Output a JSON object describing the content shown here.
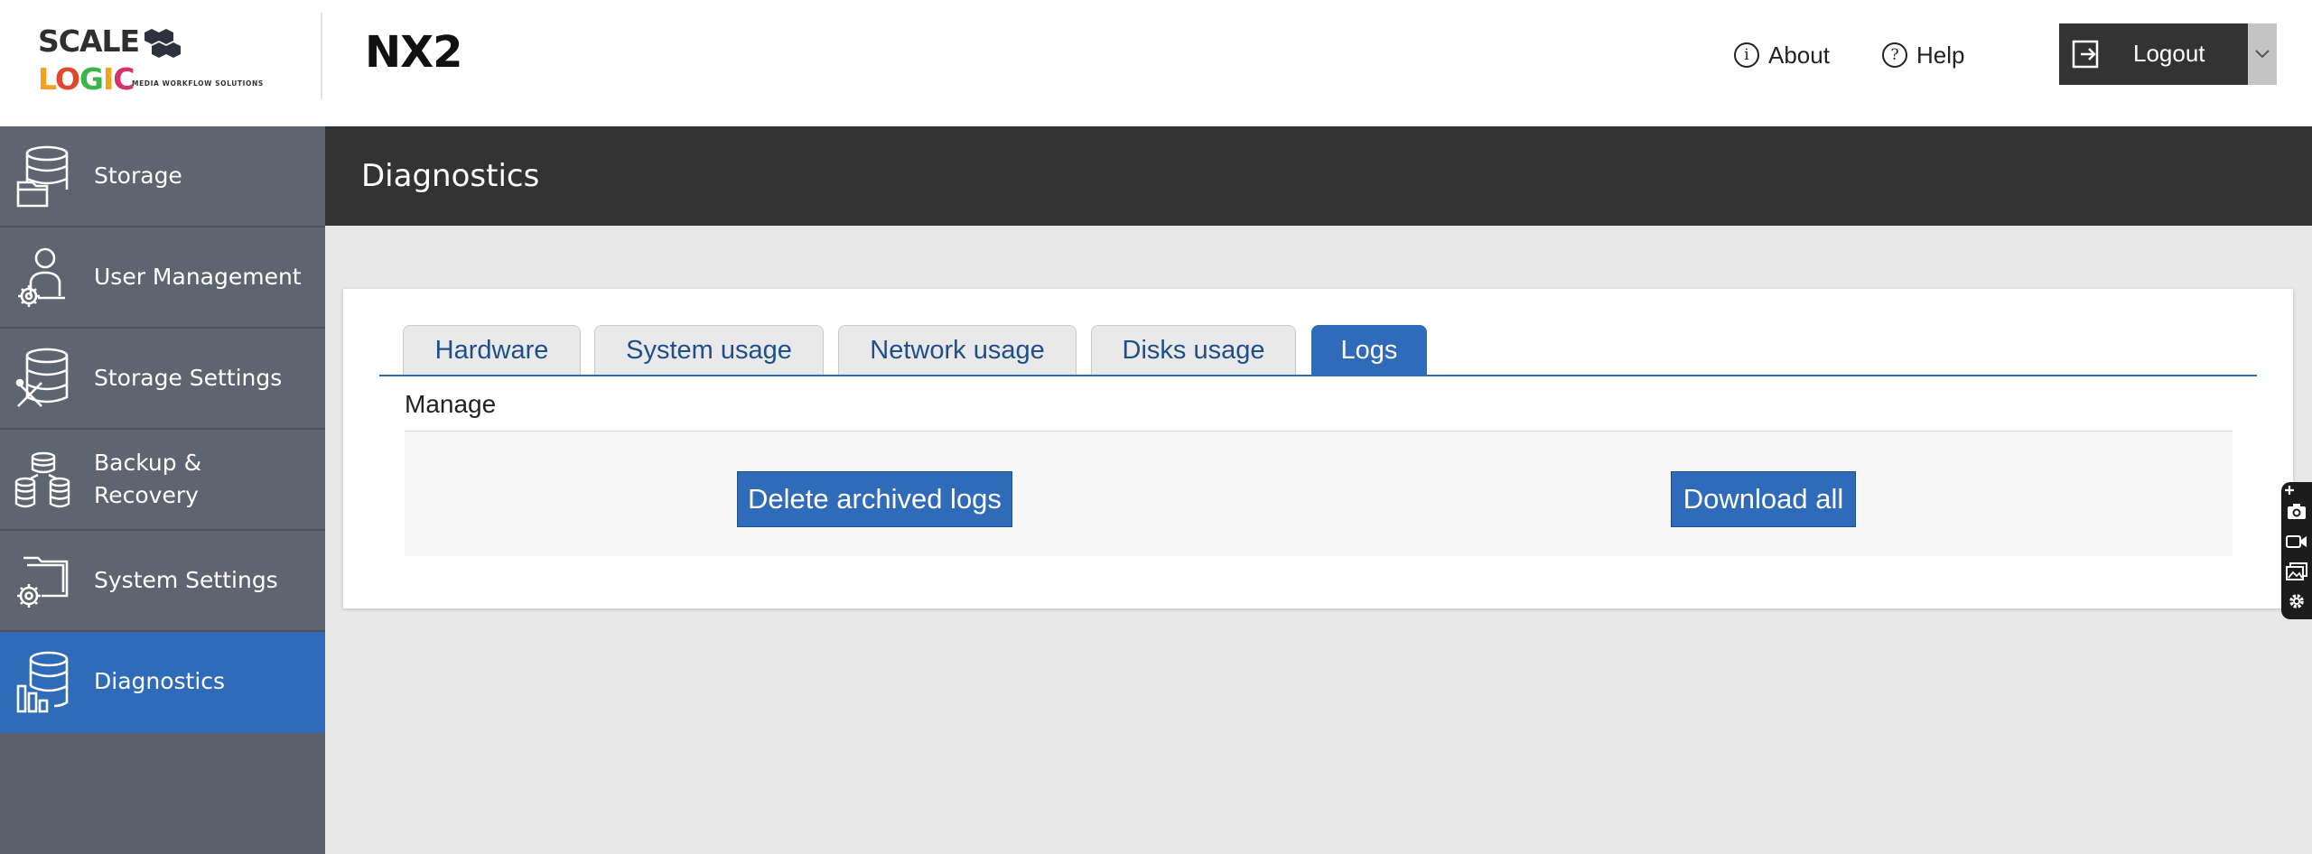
{
  "header": {
    "logo_scale": "SCALE",
    "logo_logic": "LOGIC",
    "logo_tagline": "MEDIA WORKFLOW SOLUTIONS",
    "product_name": "NX2",
    "about_label": "About",
    "help_label": "Help",
    "logout_label": "Logout"
  },
  "sidebar": {
    "items": [
      {
        "label": "Storage",
        "icon": "storage-icon"
      },
      {
        "label": "User Management",
        "icon": "user-management-icon"
      },
      {
        "label": "Storage Settings",
        "icon": "storage-settings-icon"
      },
      {
        "label": "Backup & Recovery",
        "icon": "backup-recovery-icon"
      },
      {
        "label": "System Settings",
        "icon": "system-settings-icon"
      },
      {
        "label": "Diagnostics",
        "icon": "diagnostics-icon",
        "active": true
      }
    ]
  },
  "main": {
    "title": "Diagnostics",
    "tabs": [
      {
        "label": "Hardware"
      },
      {
        "label": "System usage"
      },
      {
        "label": "Network usage"
      },
      {
        "label": "Disks usage"
      },
      {
        "label": "Logs",
        "active": true
      }
    ],
    "section_title": "Manage",
    "buttons": {
      "delete_archived_logs": "Delete archived logs",
      "download_all": "Download all"
    }
  },
  "floating_toolbar": {
    "icons": [
      "plus-icon",
      "camera-icon",
      "video-icon",
      "image-icon",
      "settings-icon"
    ]
  },
  "colors": {
    "accent": "#2f6bb8",
    "sidebar": "#5e6470",
    "title_bar": "#333333",
    "logout_bg": "#333333"
  }
}
